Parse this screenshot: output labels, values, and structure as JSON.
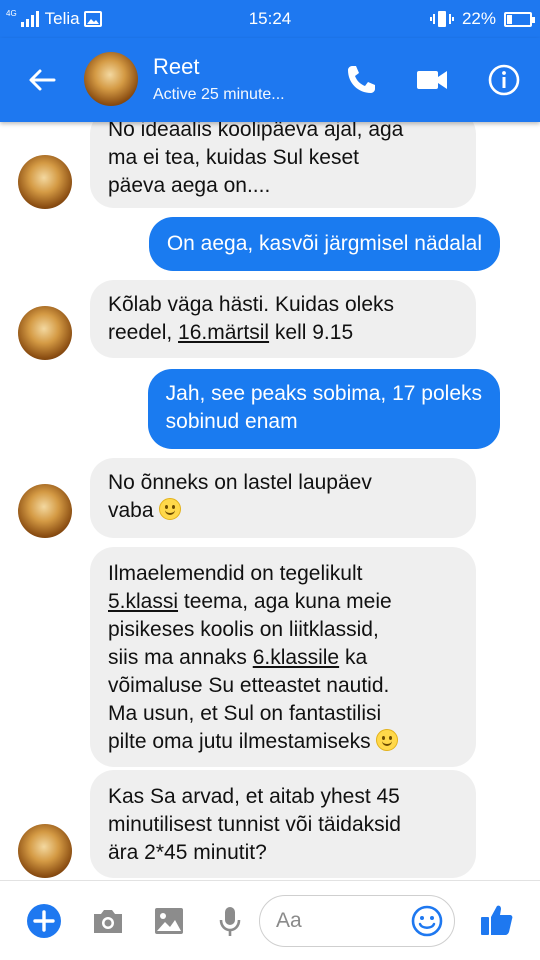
{
  "status_bar": {
    "network": "4G",
    "carrier": "Telia",
    "time": "15:24",
    "battery": "22%",
    "battery_level": 0.22
  },
  "header": {
    "name": "Reet",
    "status": "Active 25 minute..."
  },
  "messages": [
    {
      "id": "m1",
      "direction": "incoming",
      "lines": [
        "No ideaalis koolipäeva ajal, aga",
        "ma ei tea, kuidas Sul keset",
        "päeva aega on...."
      ]
    },
    {
      "id": "m2",
      "direction": "outgoing",
      "lines": [
        "On aega, kasvõi järgmisel nädalal"
      ]
    },
    {
      "id": "m3",
      "direction": "incoming",
      "lines": [
        "Kõlab väga hästi. Kuidas oleks",
        "reedel, ",
        "16.märtsil",
        " kell 9.15"
      ]
    },
    {
      "id": "m4",
      "direction": "outgoing",
      "lines": [
        "Jah, see peaks sobima, 17 poleks",
        "sobinud enam"
      ]
    },
    {
      "id": "m5",
      "direction": "incoming",
      "lines": [
        "No õnneks on lastel laupäev",
        "vaba"
      ],
      "emoji": "slightly-smiling-face"
    },
    {
      "id": "m6",
      "direction": "incoming",
      "lines": [
        "Ilmaelemendid on tegelikult",
        "5.klassi",
        " teema, aga kuna meie",
        "pisikeses koolis on liitklassid,",
        "siis ma annaks ",
        "6.klassile",
        " ka",
        "võimaluse Su etteastet nautid.",
        "Ma usun, et Sul on fantastilisi",
        "pilte oma jutu ilmestamiseks"
      ],
      "emoji": "slightly-smiling-face"
    },
    {
      "id": "m7",
      "direction": "incoming",
      "lines": [
        "Kas Sa arvad, et aitab yhest 45",
        "minutilisest tunnist või täidaksid",
        "ära 2*45 minutit?"
      ]
    }
  ],
  "composer": {
    "placeholder": "Aa"
  },
  "colors": {
    "brand": "#1e78f0",
    "outgoing_bubble": "#1a7bf0",
    "incoming_bubble": "#efefef"
  }
}
